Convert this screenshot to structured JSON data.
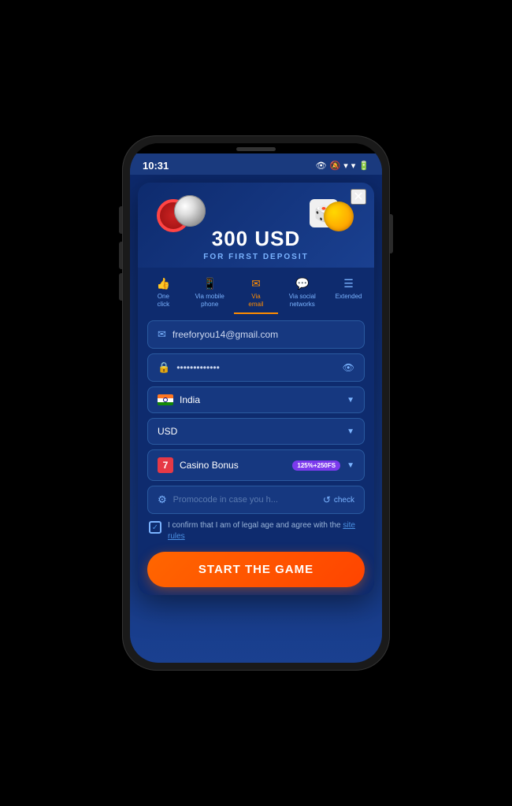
{
  "phone": {
    "status_bar": {
      "time": "10:31",
      "icons": [
        "eye",
        "bell-off",
        "wifi",
        "signal",
        "battery"
      ]
    }
  },
  "modal": {
    "close_label": "✕",
    "bonus": {
      "amount": "300",
      "currency": "USD",
      "subtitle": "FOR FIRST DEPOSIT"
    },
    "tabs": [
      {
        "id": "one-click",
        "icon": "👍",
        "label": "One\nclick",
        "active": false
      },
      {
        "id": "mobile",
        "icon": "📱",
        "label": "Via mobile\nphone",
        "active": false
      },
      {
        "id": "email",
        "icon": "✉",
        "label": "Via\nemail",
        "active": true
      },
      {
        "id": "social",
        "icon": "💬",
        "label": "Via social\nnetworks",
        "active": false
      },
      {
        "id": "extended",
        "icon": "☰",
        "label": "Extended",
        "active": false
      }
    ],
    "form": {
      "email": {
        "value": "freeforyou14@gmail.com",
        "icon": "✉"
      },
      "password": {
        "value": "•••••••••••••",
        "icon": "🔒",
        "eye_icon": "👁"
      },
      "country": {
        "value": "India",
        "chevron": "▼"
      },
      "currency": {
        "value": "USD",
        "chevron": "▼"
      },
      "bonus": {
        "icon": "7",
        "label": "Casino Bonus",
        "badge": "125%+250FS",
        "chevron": "▼"
      },
      "promo": {
        "placeholder": "Promocode in case you h...",
        "check_label": "check",
        "icon": "⚙"
      },
      "terms": {
        "checked": true,
        "text": "I confirm that I am of legal age and agree with the ",
        "link_text": "site rules"
      }
    },
    "start_button": "START THE GAME"
  }
}
